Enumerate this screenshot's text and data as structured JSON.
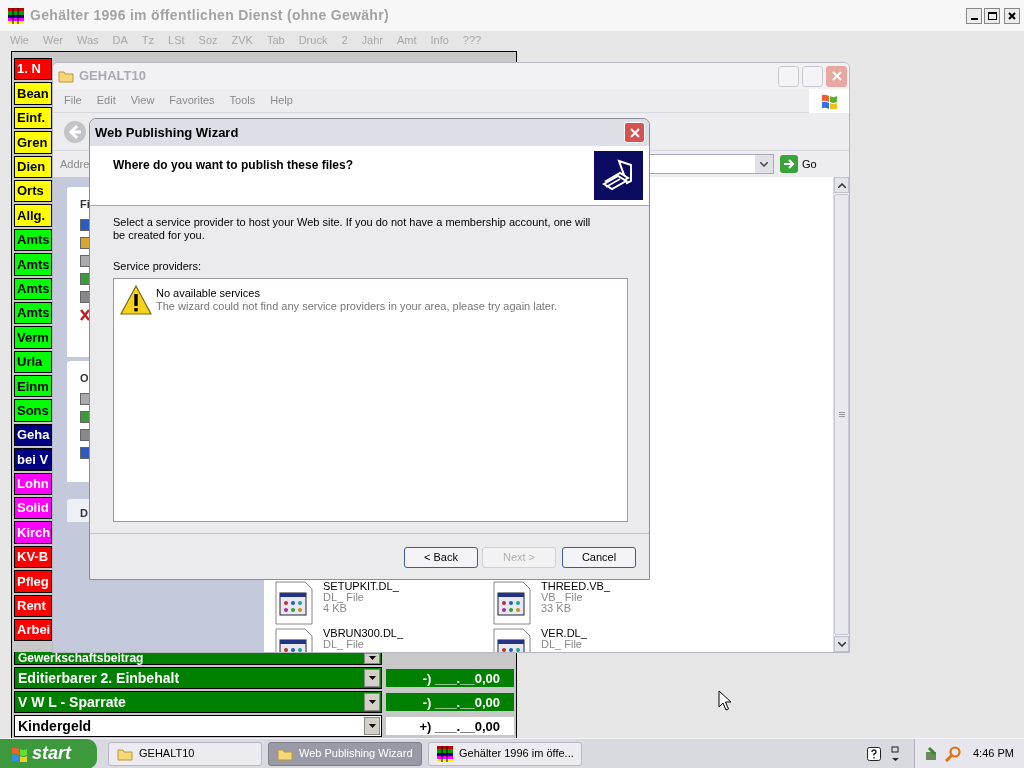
{
  "app_window": {
    "title": "Gehälter 1996 im öffentlichen Dienst (ohne Gewähr)",
    "menu": [
      "Wie",
      "Wer",
      "Was",
      "DA",
      "Tz",
      "LSt",
      "Soz",
      "ZVK",
      "Tab",
      "Druck",
      "2",
      "Jahr",
      "Amt",
      "Info",
      "???"
    ],
    "categories": [
      {
        "label": "1. N",
        "color": "#ff0000"
      },
      {
        "label": "Bean",
        "color": "#ffff00"
      },
      {
        "label": "Einf.",
        "color": "#ffff00"
      },
      {
        "label": "Gren",
        "color": "#ffff00"
      },
      {
        "label": "Dien",
        "color": "#ffff00"
      },
      {
        "label": "Orts",
        "color": "#ffff00"
      },
      {
        "label": "Allg.",
        "color": "#ffff00"
      },
      {
        "label": "Amts",
        "color": "#00ff00"
      },
      {
        "label": "Amts",
        "color": "#00ff00"
      },
      {
        "label": "Amts",
        "color": "#00ff00"
      },
      {
        "label": "Amts",
        "color": "#00ff00"
      },
      {
        "label": "Verm",
        "color": "#00ff00"
      },
      {
        "label": "Urla",
        "color": "#00ff00"
      },
      {
        "label": "Einm",
        "color": "#00ff00"
      },
      {
        "label": "Sons",
        "color": "#00ff00"
      },
      {
        "label": "Geha",
        "color": "#000080"
      },
      {
        "label": "bei V",
        "color": "#000080"
      },
      {
        "label": "Lohn",
        "color": "#ff00ff"
      },
      {
        "label": "Solid",
        "color": "#ff00ff"
      },
      {
        "label": "Kirch",
        "color": "#ff00ff"
      },
      {
        "label": "KV-B",
        "color": "#ff0000"
      },
      {
        "label": "Pfleg",
        "color": "#ff0000"
      },
      {
        "label": "Rent",
        "color": "#ff0000"
      },
      {
        "label": "Arbei",
        "color": "#ff0000"
      }
    ],
    "rows": [
      {
        "label": "Gewerkschaftsbeitrag",
        "color": "#008000"
      },
      {
        "label": "Editierbarer 2. Einbehalt",
        "color": "#008000",
        "value": "-) ___.__0,00"
      },
      {
        "label": "V W L - Sparrate",
        "color": "#008000",
        "value": "-) ___.__0,00"
      },
      {
        "label": "Kindergeld",
        "color": "#ffffff",
        "value": "+) ___.__0,00"
      }
    ]
  },
  "explorer": {
    "title": "GEHALT10",
    "menu": [
      "File",
      "Edit",
      "View",
      "Favorites",
      "Tools",
      "Help"
    ],
    "address_label": "Addre",
    "go": "Go",
    "task_pane": [
      "Fi",
      "O",
      "D"
    ],
    "files": [
      {
        "name": "SETUPKIT.DL_",
        "type": "DL_ File",
        "size": "4 KB"
      },
      {
        "name": "THREED.VB_",
        "type": "VB_ File",
        "size": "33 KB"
      },
      {
        "name": "VBRUN300.DL_",
        "type": "DL_ File"
      },
      {
        "name": "VER.DL_",
        "type": "DL_ File"
      }
    ]
  },
  "wizard": {
    "title": "Web Publishing Wizard",
    "heading": "Where do you want to publish these files?",
    "description": "Select a service provider to host your Web site.  If you do not have a membership account, one will be created for you.",
    "list_label": "Service providers:",
    "providers": [
      {
        "title": "No available services",
        "detail": "The wizard could not find any service providers in your area, please try again later."
      }
    ],
    "buttons": [
      {
        "label": "< Back",
        "disabled": false
      },
      {
        "label": "Next >",
        "disabled": true
      },
      {
        "label": "Cancel",
        "disabled": false
      }
    ]
  },
  "taskbar": {
    "start": "start",
    "tasks": [
      {
        "label": "GEHALT10",
        "kind": "folder",
        "selected": false
      },
      {
        "label": "Web Publishing Wizard",
        "kind": "folder",
        "selected": true
      },
      {
        "label": "Gehälter 1996 im öffe...",
        "kind": "app",
        "selected": false
      }
    ],
    "clock": "4:46 PM"
  }
}
